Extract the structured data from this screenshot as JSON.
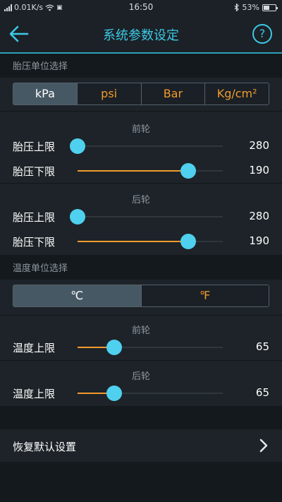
{
  "status_bar": {
    "carrier_icon": "signal-icon",
    "speed": "0.01K/s",
    "time": "16:50",
    "battery": "53%",
    "battery_level": 0.53
  },
  "header": {
    "title": "系统参数设定",
    "help_symbol": "?"
  },
  "pressure": {
    "section_label": "胎压单位选择",
    "units": [
      "kPa",
      "psi",
      "Bar",
      "Kg/cm²"
    ],
    "selected_unit": "kPa",
    "front": {
      "title": "前轮",
      "upper": {
        "label": "胎压上限",
        "value": "280",
        "level": 0.0
      },
      "lower": {
        "label": "胎压下限",
        "value": "190",
        "level": 0.76
      }
    },
    "rear": {
      "title": "后轮",
      "upper": {
        "label": "胎压上限",
        "value": "280",
        "level": 0.0
      },
      "lower": {
        "label": "胎压下限",
        "value": "190",
        "level": 0.76
      }
    }
  },
  "temperature": {
    "section_label": "温度单位选择",
    "units": [
      "℃",
      "℉"
    ],
    "selected_unit": "℃",
    "front": {
      "title": "前轮",
      "upper": {
        "label": "温度上限",
        "value": "65",
        "level": 0.25
      }
    },
    "rear": {
      "title": "后轮",
      "upper": {
        "label": "温度上限",
        "value": "65",
        "level": 0.25
      }
    }
  },
  "restore": {
    "label": "恢复默认设置"
  },
  "colors": {
    "accent": "#3cc9e6",
    "fill": "#f29a2e",
    "thumb": "#4fd0ee"
  }
}
